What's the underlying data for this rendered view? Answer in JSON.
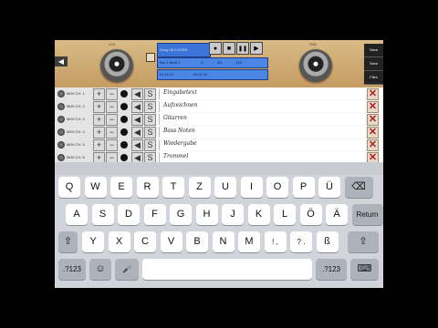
{
  "console": {
    "knob_left_label": "VOL",
    "knob_right_label": "PAN",
    "lcd_title": "Song 08 CHORD",
    "lcd_position": "Bar 1  Beat 1",
    "lcd_pos_mark": "II",
    "lcd_time": "3/4",
    "lcd_tempo": "120",
    "lcd_loop_start": "01.01.01",
    "lcd_loop_end": "01.01.01",
    "back_label": "◀",
    "side_buttons": [
      "Save",
      "Save",
      "Files"
    ],
    "transport": [
      "●",
      "■",
      "❚❚",
      "▶"
    ]
  },
  "tracks": [
    {
      "name": "MIDI CH. 1",
      "text": "Eingabetext"
    },
    {
      "name": "MIDI CH. 2",
      "text": "Aufzeichnen"
    },
    {
      "name": "MIDI CH. 3",
      "text": "Gitarren"
    },
    {
      "name": "MIDI CH. 4",
      "text": "Bass Noten"
    },
    {
      "name": "MIDI CH. 5",
      "text": "Wiedergabe"
    },
    {
      "name": "MIDI CH. 6",
      "text": "Trommel"
    }
  ],
  "track_buttons": {
    "plus": "+",
    "minus": "−",
    "mute": "◀",
    "solo": "S",
    "delete": "✕"
  },
  "keyboard": {
    "row1": [
      "Q",
      "W",
      "E",
      "R",
      "T",
      "Z",
      "U",
      "I",
      "O",
      "P",
      "Ü"
    ],
    "row2": [
      "A",
      "S",
      "D",
      "F",
      "G",
      "H",
      "J",
      "K",
      "L",
      "Ö",
      "Ä"
    ],
    "row3": [
      "Y",
      "X",
      "C",
      "V",
      "B",
      "N",
      "M",
      "!\n,",
      "?\n.",
      "ß"
    ],
    "backspace": "⌫",
    "return": "Return",
    "shift": "⇧",
    "numbers": ".?123",
    "emoji": "☺",
    "mic": "🎤",
    "space": "",
    "dismiss": "⌨"
  }
}
